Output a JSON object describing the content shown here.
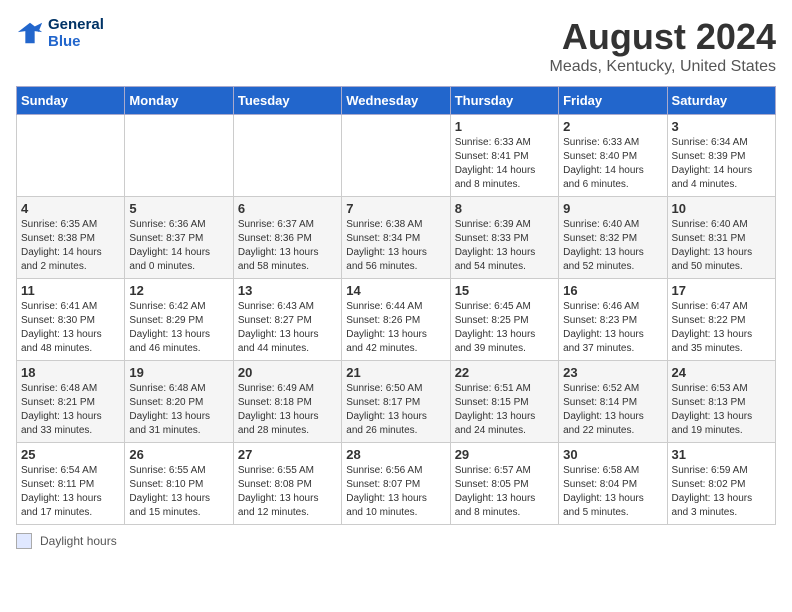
{
  "header": {
    "logo_line1": "General",
    "logo_line2": "Blue",
    "main_title": "August 2024",
    "subtitle": "Meads, Kentucky, United States"
  },
  "days_of_week": [
    "Sunday",
    "Monday",
    "Tuesday",
    "Wednesday",
    "Thursday",
    "Friday",
    "Saturday"
  ],
  "weeks": [
    [
      {
        "date": "",
        "info": ""
      },
      {
        "date": "",
        "info": ""
      },
      {
        "date": "",
        "info": ""
      },
      {
        "date": "",
        "info": ""
      },
      {
        "date": "1",
        "info": "Sunrise: 6:33 AM\nSunset: 8:41 PM\nDaylight: 14 hours\nand 8 minutes."
      },
      {
        "date": "2",
        "info": "Sunrise: 6:33 AM\nSunset: 8:40 PM\nDaylight: 14 hours\nand 6 minutes."
      },
      {
        "date": "3",
        "info": "Sunrise: 6:34 AM\nSunset: 8:39 PM\nDaylight: 14 hours\nand 4 minutes."
      }
    ],
    [
      {
        "date": "4",
        "info": "Sunrise: 6:35 AM\nSunset: 8:38 PM\nDaylight: 14 hours\nand 2 minutes."
      },
      {
        "date": "5",
        "info": "Sunrise: 6:36 AM\nSunset: 8:37 PM\nDaylight: 14 hours\nand 0 minutes."
      },
      {
        "date": "6",
        "info": "Sunrise: 6:37 AM\nSunset: 8:36 PM\nDaylight: 13 hours\nand 58 minutes."
      },
      {
        "date": "7",
        "info": "Sunrise: 6:38 AM\nSunset: 8:34 PM\nDaylight: 13 hours\nand 56 minutes."
      },
      {
        "date": "8",
        "info": "Sunrise: 6:39 AM\nSunset: 8:33 PM\nDaylight: 13 hours\nand 54 minutes."
      },
      {
        "date": "9",
        "info": "Sunrise: 6:40 AM\nSunset: 8:32 PM\nDaylight: 13 hours\nand 52 minutes."
      },
      {
        "date": "10",
        "info": "Sunrise: 6:40 AM\nSunset: 8:31 PM\nDaylight: 13 hours\nand 50 minutes."
      }
    ],
    [
      {
        "date": "11",
        "info": "Sunrise: 6:41 AM\nSunset: 8:30 PM\nDaylight: 13 hours\nand 48 minutes."
      },
      {
        "date": "12",
        "info": "Sunrise: 6:42 AM\nSunset: 8:29 PM\nDaylight: 13 hours\nand 46 minutes."
      },
      {
        "date": "13",
        "info": "Sunrise: 6:43 AM\nSunset: 8:27 PM\nDaylight: 13 hours\nand 44 minutes."
      },
      {
        "date": "14",
        "info": "Sunrise: 6:44 AM\nSunset: 8:26 PM\nDaylight: 13 hours\nand 42 minutes."
      },
      {
        "date": "15",
        "info": "Sunrise: 6:45 AM\nSunset: 8:25 PM\nDaylight: 13 hours\nand 39 minutes."
      },
      {
        "date": "16",
        "info": "Sunrise: 6:46 AM\nSunset: 8:23 PM\nDaylight: 13 hours\nand 37 minutes."
      },
      {
        "date": "17",
        "info": "Sunrise: 6:47 AM\nSunset: 8:22 PM\nDaylight: 13 hours\nand 35 minutes."
      }
    ],
    [
      {
        "date": "18",
        "info": "Sunrise: 6:48 AM\nSunset: 8:21 PM\nDaylight: 13 hours\nand 33 minutes."
      },
      {
        "date": "19",
        "info": "Sunrise: 6:48 AM\nSunset: 8:20 PM\nDaylight: 13 hours\nand 31 minutes."
      },
      {
        "date": "20",
        "info": "Sunrise: 6:49 AM\nSunset: 8:18 PM\nDaylight: 13 hours\nand 28 minutes."
      },
      {
        "date": "21",
        "info": "Sunrise: 6:50 AM\nSunset: 8:17 PM\nDaylight: 13 hours\nand 26 minutes."
      },
      {
        "date": "22",
        "info": "Sunrise: 6:51 AM\nSunset: 8:15 PM\nDaylight: 13 hours\nand 24 minutes."
      },
      {
        "date": "23",
        "info": "Sunrise: 6:52 AM\nSunset: 8:14 PM\nDaylight: 13 hours\nand 22 minutes."
      },
      {
        "date": "24",
        "info": "Sunrise: 6:53 AM\nSunset: 8:13 PM\nDaylight: 13 hours\nand 19 minutes."
      }
    ],
    [
      {
        "date": "25",
        "info": "Sunrise: 6:54 AM\nSunset: 8:11 PM\nDaylight: 13 hours\nand 17 minutes."
      },
      {
        "date": "26",
        "info": "Sunrise: 6:55 AM\nSunset: 8:10 PM\nDaylight: 13 hours\nand 15 minutes."
      },
      {
        "date": "27",
        "info": "Sunrise: 6:55 AM\nSunset: 8:08 PM\nDaylight: 13 hours\nand 12 minutes."
      },
      {
        "date": "28",
        "info": "Sunrise: 6:56 AM\nSunset: 8:07 PM\nDaylight: 13 hours\nand 10 minutes."
      },
      {
        "date": "29",
        "info": "Sunrise: 6:57 AM\nSunset: 8:05 PM\nDaylight: 13 hours\nand 8 minutes."
      },
      {
        "date": "30",
        "info": "Sunrise: 6:58 AM\nSunset: 8:04 PM\nDaylight: 13 hours\nand 5 minutes."
      },
      {
        "date": "31",
        "info": "Sunrise: 6:59 AM\nSunset: 8:02 PM\nDaylight: 13 hours\nand 3 minutes."
      }
    ]
  ],
  "footer": {
    "legend_label": "Daylight hours"
  }
}
